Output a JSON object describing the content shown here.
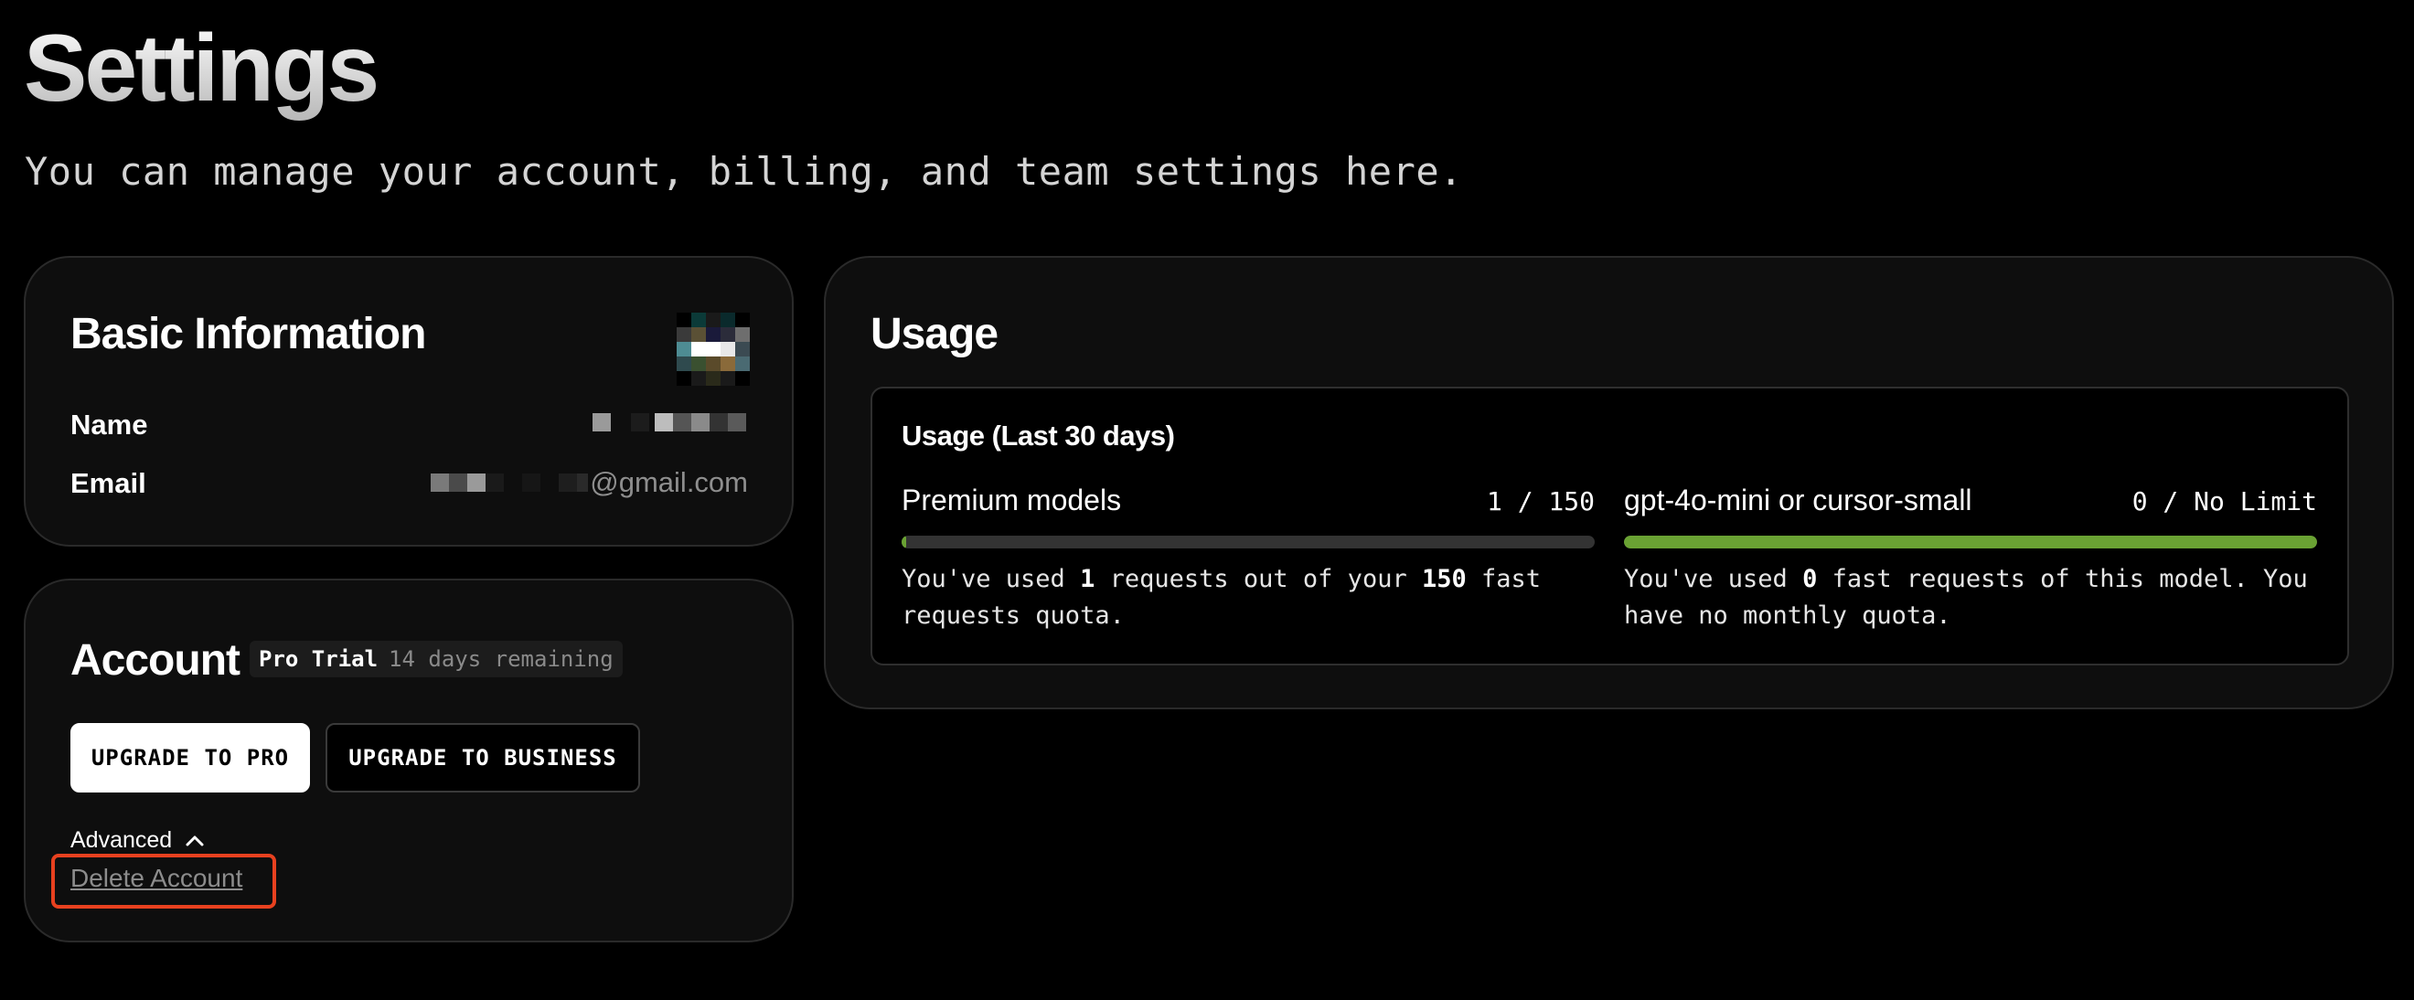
{
  "header": {
    "title": "Settings",
    "subtitle": "You can manage your account, billing, and team settings here."
  },
  "basic_info": {
    "title": "Basic Information",
    "name_label": "Name",
    "email_label": "Email",
    "email_suffix": "@gmail.com",
    "avatar_colors": [
      [
        "#000000",
        "#0b3a38",
        "#1a1a1a",
        "#0a2a2c",
        "#000000"
      ],
      [
        "#3a3a3a",
        "#5a5035",
        "#1a1a3a",
        "#2b2c3a",
        "#6e6e6e"
      ],
      [
        "#4e8c93",
        "#ffffff",
        "#ffffff",
        "#e8e8e8",
        "#3b4a52"
      ],
      [
        "#2f4a4e",
        "#3a5030",
        "#5a4a2a",
        "#8a6a3a",
        "#4a6a72"
      ],
      [
        "#000000",
        "#1a1a1a",
        "#2a2a1a",
        "#1a1a1a",
        "#000000"
      ]
    ]
  },
  "account": {
    "title": "Account",
    "plan": "Pro Trial",
    "remaining": "14 days remaining",
    "upgrade_pro_label": "UPGRADE TO PRO",
    "upgrade_business_label": "UPGRADE TO BUSINESS",
    "advanced_label": "Advanced",
    "delete_label": "Delete Account"
  },
  "usage": {
    "title": "Usage",
    "panel_title": "Usage (Last 30 days)",
    "premium": {
      "name": "Premium models",
      "count": "1 / 150",
      "progress_fraction": 0.0067,
      "desc_prefix": "You've used ",
      "desc_used": "1",
      "desc_mid": " requests out of your ",
      "desc_quota": "150",
      "desc_suffix": " fast requests quota."
    },
    "mini": {
      "name": "gpt-4o-mini or cursor-small",
      "count": "0 / No Limit",
      "progress_fraction": 1.0,
      "desc_prefix": "You've used ",
      "desc_used": "0",
      "desc_suffix": " fast requests of this model. You have no monthly quota."
    }
  },
  "colors": {
    "accent_green": "#6aa233",
    "highlight_red": "#e8411f"
  }
}
